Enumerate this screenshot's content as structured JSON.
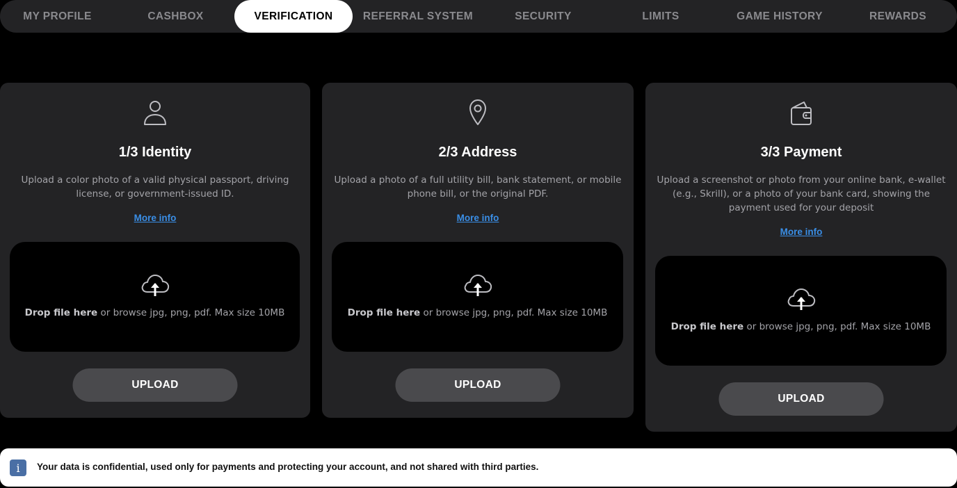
{
  "tabs": [
    {
      "label": "MY PROFILE",
      "active": false
    },
    {
      "label": "CASHBOX",
      "active": false
    },
    {
      "label": "VERIFICATION",
      "active": true
    },
    {
      "label": "REFERRAL SYSTEM",
      "active": false
    },
    {
      "label": "SECURITY",
      "active": false
    },
    {
      "label": "LIMITS",
      "active": false
    },
    {
      "label": "GAME HISTORY",
      "active": false
    },
    {
      "label": "REWARDS",
      "active": false
    }
  ],
  "cards": [
    {
      "icon": "person-icon",
      "title": "1/3 Identity",
      "description": "Upload a color photo of a valid physical passport, driving license, or government-issued ID.",
      "more_info": "More info",
      "drop_bold": "Drop file here",
      "drop_rest": " or browse jpg, png, pdf. Max size 10MB",
      "upload_label": "UPLOAD"
    },
    {
      "icon": "location-pin-icon",
      "title": "2/3 Address",
      "description": "Upload a photo of a full utility bill, bank statement, or mobile phone bill, or the original PDF.",
      "more_info": "More info",
      "drop_bold": "Drop file here",
      "drop_rest": " or browse jpg, png, pdf. Max size 10MB",
      "upload_label": "UPLOAD"
    },
    {
      "icon": "wallet-icon",
      "title": "3/3 Payment",
      "description": "Upload a screenshot or photo from your online bank, e-wallet (e.g., Skrill), or a photo of your bank card, showing the payment used for your deposit",
      "more_info": "More info",
      "drop_bold": "Drop file here",
      "drop_rest": " or browse jpg, png, pdf. Max size 10MB",
      "upload_label": "UPLOAD"
    }
  ],
  "notice": {
    "icon": "info-icon",
    "icon_glyph": "i",
    "text": "Your data is confidential, used only for payments and protecting your account, and not shared with third parties."
  },
  "colors": {
    "background": "#000000",
    "card": "#232325",
    "link": "#3a8ee6",
    "button": "#4a4a4d",
    "info_badge": "#4a6fa5"
  }
}
